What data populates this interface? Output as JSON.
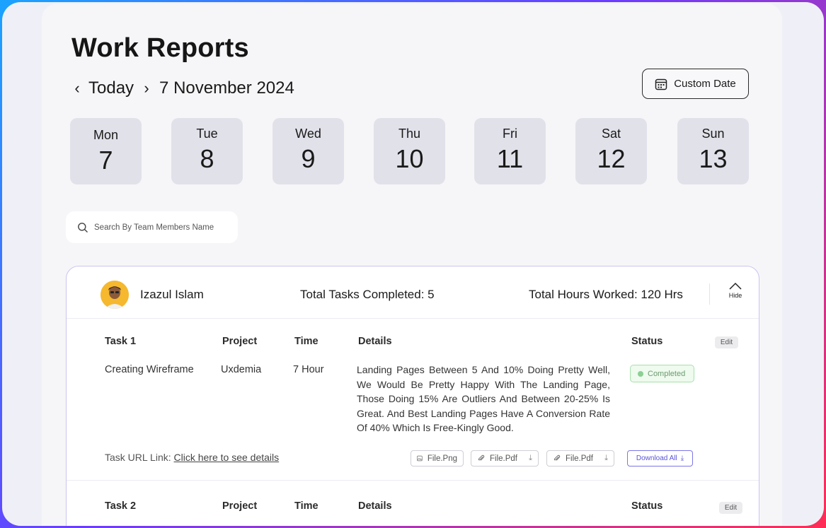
{
  "page": {
    "title": "Work Reports"
  },
  "date_nav": {
    "prev_icon": "chevron-left-icon",
    "today": "Today",
    "next_icon": "chevron-right-icon",
    "current_date": "7 November 2024"
  },
  "custom_date": {
    "label": "Custom Date",
    "icon": "calendar-icon"
  },
  "days": [
    {
      "name": "Mon",
      "num": "7"
    },
    {
      "name": "Tue",
      "num": "8"
    },
    {
      "name": "Wed",
      "num": "9"
    },
    {
      "name": "Thu",
      "num": "10"
    },
    {
      "name": "Fri",
      "num": "11"
    },
    {
      "name": "Sat",
      "num": "12"
    },
    {
      "name": "Sun",
      "num": "13"
    }
  ],
  "search": {
    "placeholder": "Search By Team Members Name",
    "icon": "search-icon"
  },
  "member": {
    "name": "Izazul Islam",
    "tasks_completed": "Total Tasks Completed: 5",
    "hours_worked": "Total Hours Worked: 120 Hrs",
    "hide_label": "Hide"
  },
  "columns": {
    "project": "Project",
    "time": "Time",
    "details": "Details",
    "status": "Status",
    "edit": "Edit"
  },
  "tasks": [
    {
      "label": "Task 1",
      "title": "Creating Wireframe",
      "project": "Uxdemia",
      "time": "7 Hour",
      "details": "Landing Pages Between 5 And 10% Doing Pretty Well, We Would Be Pretty Happy With The Landing Page, Those Doing 15% Are Outliers And Between 20-25% Is Great. And Best Landing Pages Have A Conversion Rate Of 40% Which Is Free-Kingly Good.",
      "status": "Completed",
      "url_label": "Task URL Link:",
      "url_link": "Click here to see details",
      "files": [
        "File.Png",
        "File.Pdf",
        "File.Pdf"
      ],
      "download_all": "Download All"
    },
    {
      "label": "Task 2"
    }
  ],
  "colors": {
    "accent": "#5a55d6",
    "status_green": "#8ccf94",
    "day_bg": "#e1e1ea"
  }
}
